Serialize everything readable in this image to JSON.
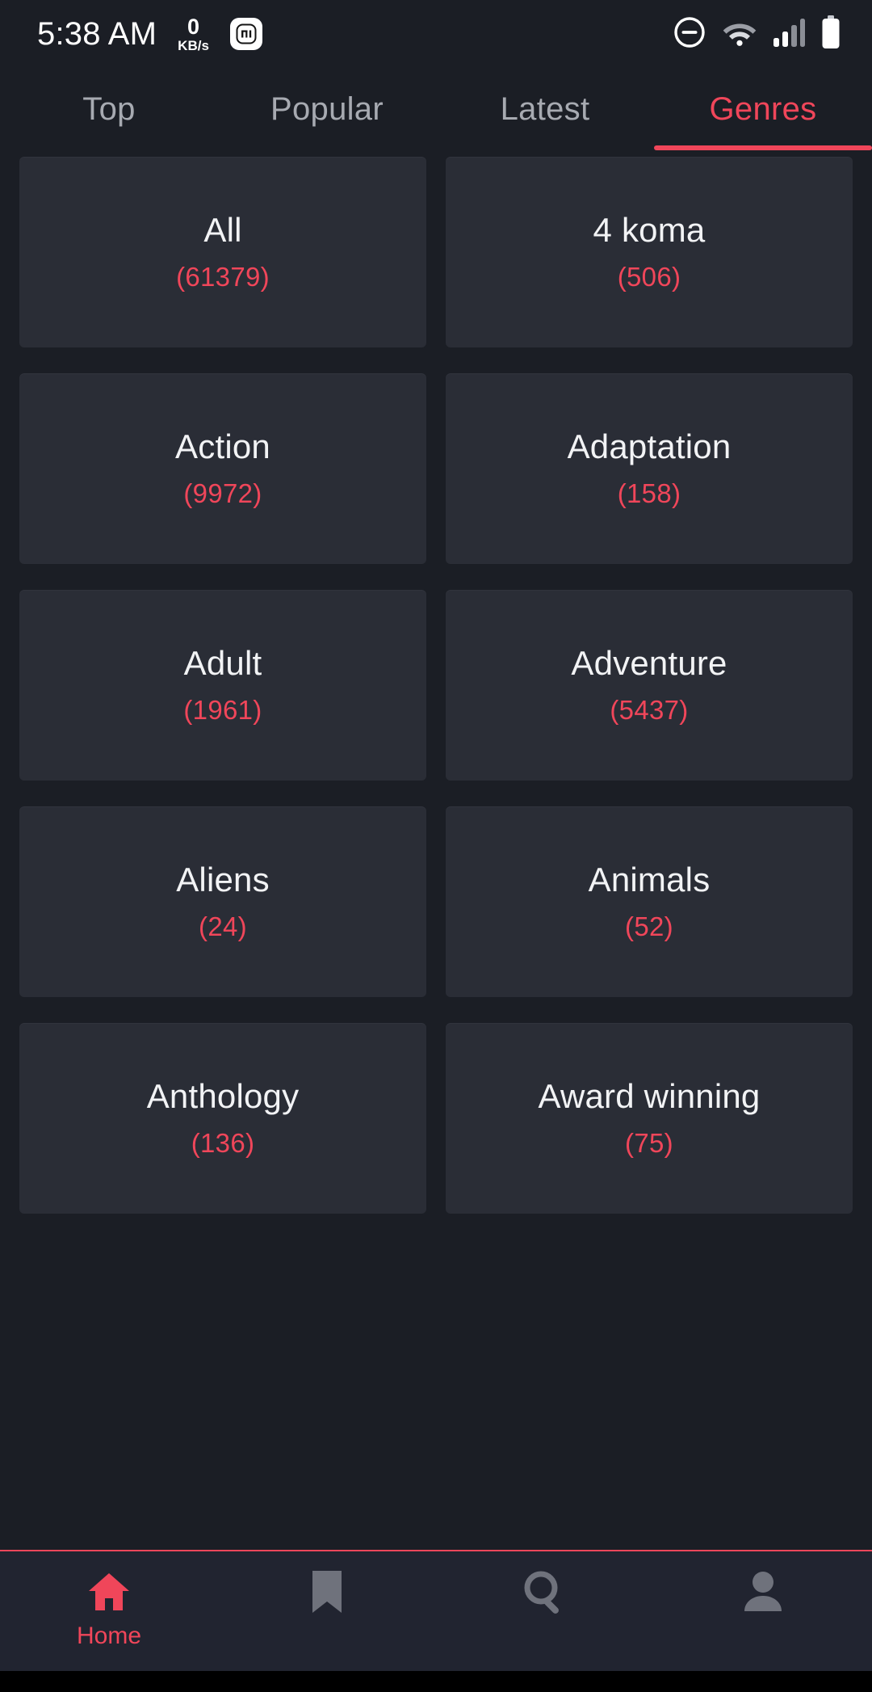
{
  "status_bar": {
    "time": "5:38 AM",
    "net_speed_value": "0",
    "net_speed_unit": "KB/s",
    "app_badge_icon": "mi-app-icon",
    "icons": [
      "do-not-disturb-icon",
      "wifi-icon",
      "signal-bars-icon",
      "battery-icon"
    ]
  },
  "tabs": {
    "items": [
      {
        "label": "Top",
        "active": false
      },
      {
        "label": "Popular",
        "active": false
      },
      {
        "label": "Latest",
        "active": false
      },
      {
        "label": "Genres",
        "active": true
      }
    ],
    "active_index": 3,
    "active_color": "#f0465a",
    "inactive_color": "#a7aab1"
  },
  "genres": {
    "count_color": "#f0465a",
    "items": [
      {
        "name": "All",
        "count": "(61379)"
      },
      {
        "name": "4 koma",
        "count": "(506)"
      },
      {
        "name": "Action",
        "count": "(9972)"
      },
      {
        "name": "Adaptation",
        "count": "(158)"
      },
      {
        "name": "Adult",
        "count": "(1961)"
      },
      {
        "name": "Adventure",
        "count": "(5437)"
      },
      {
        "name": "Aliens",
        "count": "(24)"
      },
      {
        "name": "Animals",
        "count": "(52)"
      },
      {
        "name": "Anthology",
        "count": "(136)"
      },
      {
        "name": "Award winning",
        "count": "(75)"
      }
    ]
  },
  "bottom_nav": {
    "accent_color": "#f0465a",
    "inactive_color": "#6f727c",
    "items": [
      {
        "label": "Home",
        "icon": "home-icon",
        "active": true
      },
      {
        "label": "",
        "icon": "bookmark-icon",
        "active": false
      },
      {
        "label": "",
        "icon": "search-icon",
        "active": false
      },
      {
        "label": "",
        "icon": "person-icon",
        "active": false
      }
    ]
  }
}
